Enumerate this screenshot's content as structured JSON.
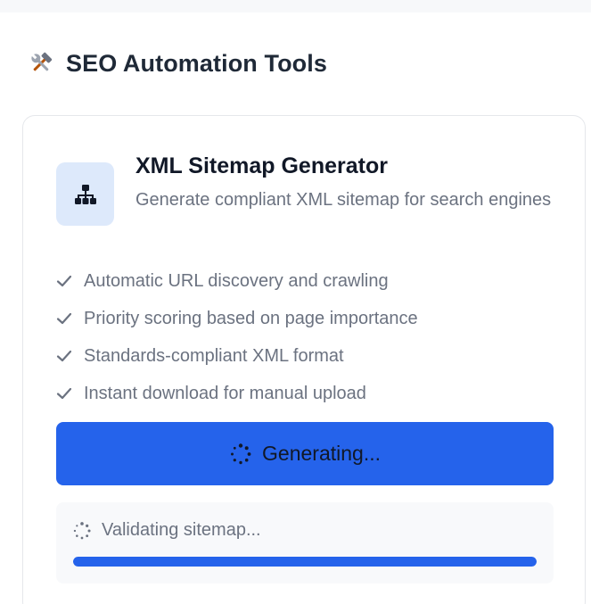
{
  "section": {
    "icon": "hammer-and-wrench-icon",
    "title": "SEO Automation Tools"
  },
  "tool": {
    "icon": "sitemap-icon",
    "title": "XML Sitemap Generator",
    "description": "Generate compliant XML sitemap for search engines",
    "features": [
      "Automatic URL discovery and crawling",
      "Priority scoring based on page importance",
      "Standards-compliant XML format",
      "Instant download for manual upload"
    ],
    "button_label": "Generating...",
    "status_text": "Validating sitemap...",
    "progress": 1.0
  },
  "colors": {
    "accent": "#2563eb",
    "icon_bg": "#dde9fb",
    "muted_text": "#6b7280"
  }
}
